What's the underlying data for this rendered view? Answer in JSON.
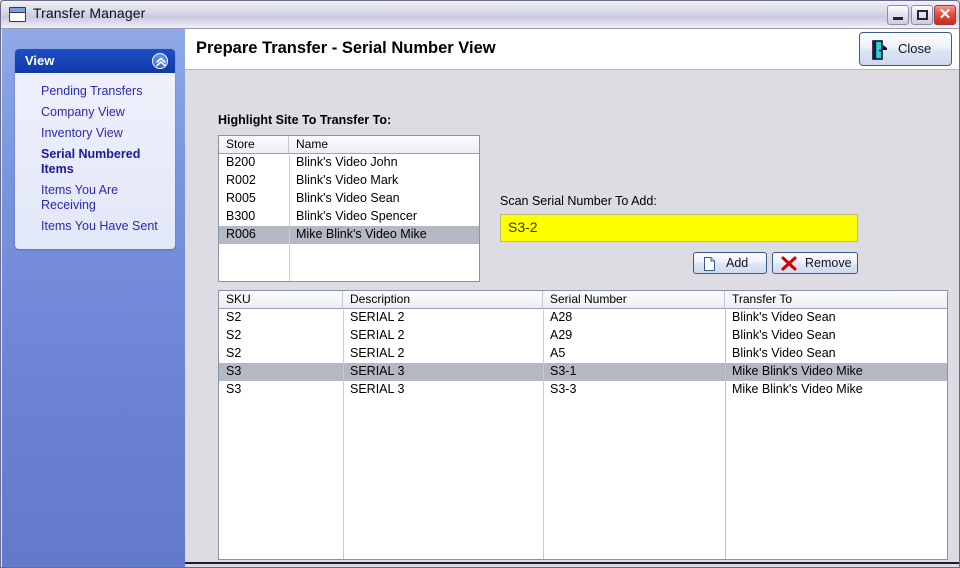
{
  "window": {
    "title": "Transfer Manager",
    "icon": "window-icon",
    "controls": {
      "minimize": "minimize-icon",
      "maximize": "maximize-icon",
      "close": "✕"
    }
  },
  "sidebar": {
    "panel_title": "View",
    "collapse_icon": "chevron-double-up-icon",
    "items": [
      {
        "label": "Pending Transfers",
        "active": false
      },
      {
        "label": "Company View",
        "active": false
      },
      {
        "label": "Inventory View",
        "active": false
      },
      {
        "label": "Serial Numbered Items",
        "active": true
      },
      {
        "label": "Items You Are Receiving",
        "active": false
      },
      {
        "label": "Items You Have Sent",
        "active": false
      }
    ]
  },
  "header": {
    "page_title": "Prepare Transfer - Serial Number View",
    "close_label": "Close",
    "close_icon": "exit-door-icon"
  },
  "form": {
    "highlight_label": "Highlight Site To Transfer To:",
    "scan_label": "Scan Serial Number To Add:",
    "scan_value": "S3-2",
    "scan_placeholder": "",
    "add_label": "Add",
    "add_icon": "page-icon",
    "remove_label": "Remove",
    "remove_icon": "red-x-icon"
  },
  "store_table": {
    "columns": [
      "Store",
      "Name"
    ],
    "rows": [
      {
        "store": "B200",
        "name": "Blink's Video John",
        "selected": false
      },
      {
        "store": "R002",
        "name": "Blink's Video Mark",
        "selected": false
      },
      {
        "store": "R005",
        "name": "Blink's Video Sean",
        "selected": false
      },
      {
        "store": "B300",
        "name": "Blink's Video Spencer",
        "selected": false
      },
      {
        "store": "R006",
        "name": "Mike Blink's Video Mike",
        "selected": true
      }
    ]
  },
  "grid": {
    "columns": [
      "SKU",
      "Description",
      "Serial Number",
      "Transfer To"
    ],
    "rows": [
      {
        "sku": "S2",
        "description": "SERIAL 2",
        "serial": "A28",
        "transfer_to": "Blink's Video Sean",
        "selected": false
      },
      {
        "sku": "S2",
        "description": "SERIAL 2",
        "serial": "A29",
        "transfer_to": "Blink's Video Sean",
        "selected": false
      },
      {
        "sku": "S2",
        "description": "SERIAL 2",
        "serial": "A5",
        "transfer_to": "Blink's Video Sean",
        "selected": false
      },
      {
        "sku": "S3",
        "description": "SERIAL 3",
        "serial": "S3-1",
        "transfer_to": "Mike Blink's Video Mike",
        "selected": true
      },
      {
        "sku": "S3",
        "description": "SERIAL 3",
        "serial": "S3-3",
        "transfer_to": "Mike Blink's Video Mike",
        "selected": false
      }
    ]
  },
  "colors": {
    "sidebar_blue": "#7a94de",
    "header_blue": "#1742b4",
    "link_blue": "#2a2ab0",
    "selection_gray": "#b4b7c4",
    "scan_yellow": "#ffff00",
    "panel_gray": "#dcdce2",
    "close_red": "#e2503e"
  }
}
